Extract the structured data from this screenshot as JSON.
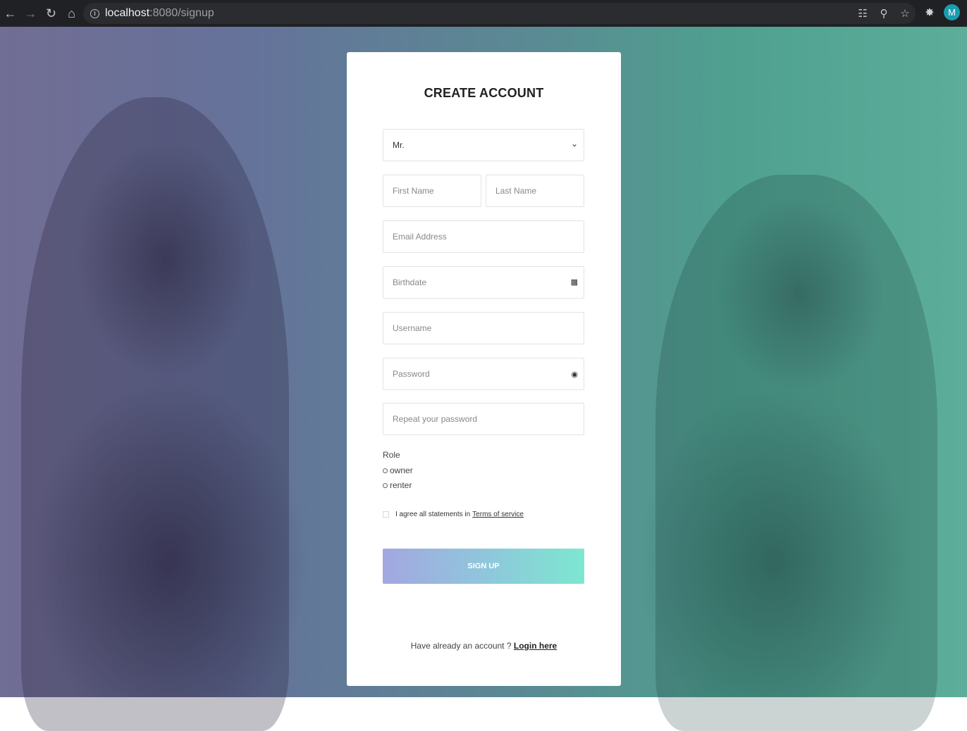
{
  "browser": {
    "url_host": "localhost",
    "url_rest": ":8080/signup",
    "profile_initial": "M",
    "icons": [
      "back-icon",
      "forward-icon",
      "reload-icon",
      "home-icon",
      "translate-icon",
      "zoom-icon",
      "bookmark-star-icon",
      "extensions-icon"
    ]
  },
  "form": {
    "title": "CREATE ACCOUNT",
    "salutation_value": "Mr.",
    "first_name_placeholder": "First Name",
    "last_name_placeholder": "Last Name",
    "email_placeholder": "Email Address",
    "birthdate_placeholder": "Birthdate",
    "username_placeholder": "Username",
    "password_placeholder": "Password",
    "repeat_password_placeholder": "Repeat your password",
    "role_label": "Role",
    "roles": [
      "owner",
      "renter"
    ],
    "agree_text": "I agree all statements in",
    "terms_link": "Terms of service",
    "signup_button": "SIGN UP",
    "login_prompt": "Have already an account ?",
    "login_link": "Login here"
  },
  "colors": {
    "accent_gradient_start": "#a3a7e0",
    "accent_gradient_end": "#7de7d0",
    "avatar_bg": "#1a9db0"
  }
}
